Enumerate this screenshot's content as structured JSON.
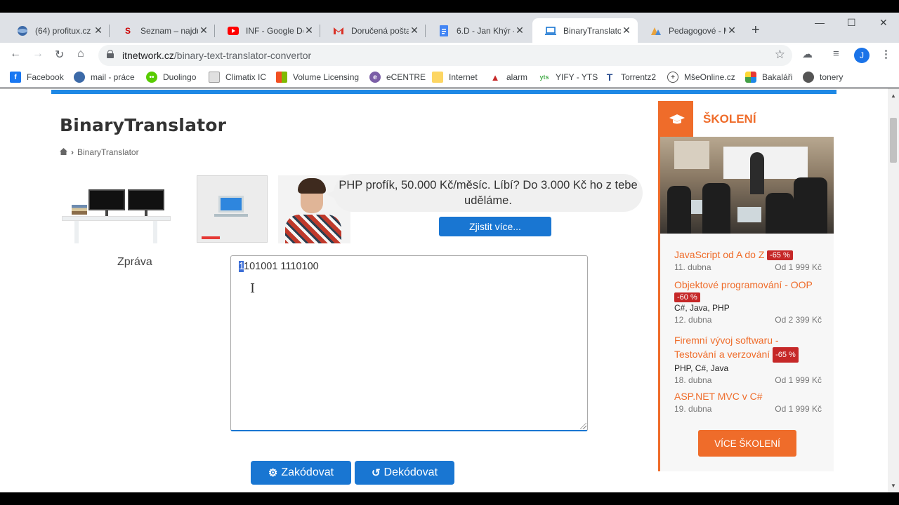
{
  "browser": {
    "tabs": [
      {
        "title": "(64) profitux.cz \\",
        "icon": "globe-icon",
        "color": "#3c6aa8"
      },
      {
        "title": "Seznam – najdu",
        "icon": "seznam-icon",
        "color": "#cc0000"
      },
      {
        "title": "INF - Google Do",
        "icon": "youtube-icon",
        "color": "#ff0000"
      },
      {
        "title": "Doručená pošta",
        "icon": "gmail-icon",
        "color": "#d93025"
      },
      {
        "title": "6.D - Jan Khýr -",
        "icon": "docs-icon",
        "color": "#4285f4"
      },
      {
        "title": "BinaryTranslator",
        "icon": "laptop-icon",
        "color": "#1976d2",
        "active": true
      },
      {
        "title": "Pedagogové - M",
        "icon": "people-icon",
        "color": "#e8a33d"
      }
    ],
    "url_host": "itnetwork.cz",
    "url_path": "/binary-text-translator-convertor",
    "avatar_letter": "J",
    "bookmarks": [
      {
        "label": "Facebook",
        "color": "#1877f2",
        "glyph": "f"
      },
      {
        "label": "mail - práce",
        "color": "#3c6aa8",
        "glyph": ""
      },
      {
        "label": "Duolingo",
        "color": "#58cc02",
        "glyph": ""
      },
      {
        "label": "Climatix IC",
        "color": "#9e9e9e",
        "glyph": ""
      },
      {
        "label": "Volume Licensing",
        "color": "#f25022",
        "glyph": ""
      },
      {
        "label": "eCENTRE",
        "color": "#7b5ea7",
        "glyph": "e"
      },
      {
        "label": "Internet",
        "color": "#fdd663",
        "glyph": ""
      },
      {
        "label": "alarm",
        "color": "#c62828",
        "glyph": ""
      },
      {
        "label": "YIFY - YTS",
        "color": "#4caf50",
        "glyph": ""
      },
      {
        "label": "Torrentz2",
        "color": "#2a4d8f",
        "glyph": "T"
      },
      {
        "label": "MšeOnline.cz",
        "color": "#555555",
        "glyph": "+"
      },
      {
        "label": "Bakaláři",
        "color": "#e53935",
        "glyph": ""
      },
      {
        "label": "tonery",
        "color": "#555555",
        "glyph": ""
      }
    ]
  },
  "page": {
    "title": "BinaryTranslator",
    "breadcrumb": "BinaryTranslator",
    "promo_text": "PHP profík, 50.000 Kč/měsíc. Líbí? Do 3.000 Kč ho z tebe uděláme.",
    "promo_button": "Zjistit více...",
    "message_label": "Zpráva",
    "input_selected": "1",
    "input_rest": "101001 1110100",
    "encode_label": "Zakódovat",
    "decode_label": "Dekódovat"
  },
  "sidebar": {
    "title": "ŠKOLENÍ",
    "courses": [
      {
        "name": "JavaScript od A do Z",
        "badge": "-65 %",
        "tech": "",
        "date": "11. dubna",
        "price": "Od 1 999 Kč"
      },
      {
        "name": "Objektové programování - OOP",
        "badge": "-60 %",
        "tech": "C#, Java, PHP",
        "date": "12. dubna",
        "price": "Od 2 399 Kč"
      },
      {
        "name": "Firemní vývoj softwaru - Testování a verzování",
        "badge": "-65 %",
        "tech": "PHP, C#, Java",
        "date": "18. dubna",
        "price": "Od 1 999 Kč"
      },
      {
        "name": "ASP.NET MVC v C#",
        "badge": "",
        "tech": "",
        "date": "19. dubna",
        "price": "Od 1 999 Kč"
      }
    ],
    "more_label": "VÍCE ŠKOLENÍ",
    "accent": "#ef6c2a"
  }
}
